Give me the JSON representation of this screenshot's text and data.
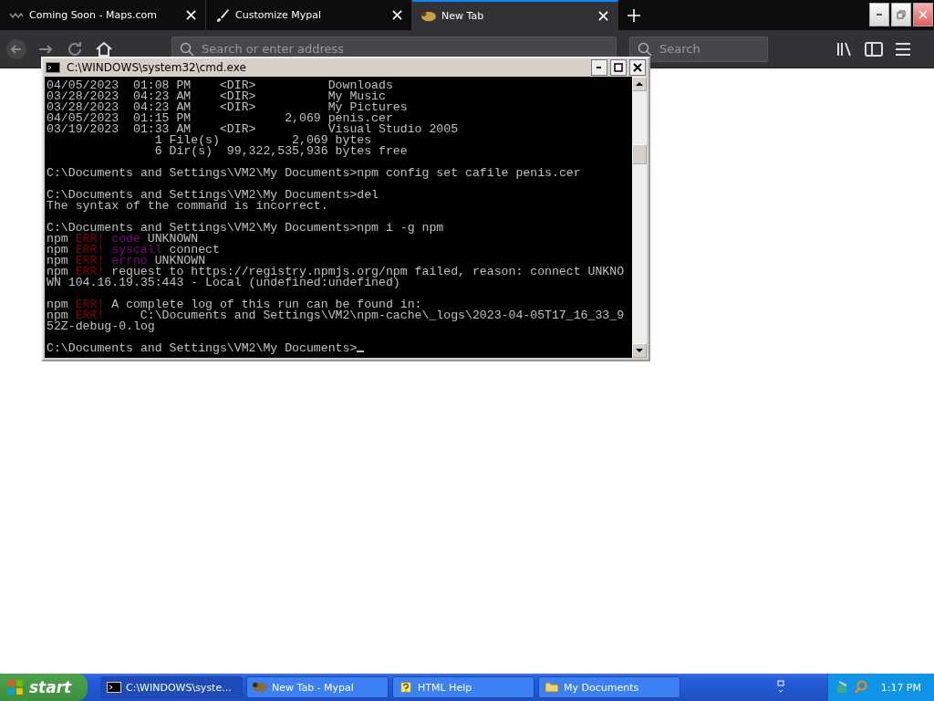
{
  "browser": {
    "tabs": [
      {
        "label": "Coming Soon - Maps.com",
        "selected": false
      },
      {
        "label": "Customize Mypal",
        "selected": false
      },
      {
        "label": "New Tab",
        "selected": true
      }
    ],
    "address": {
      "placeholder": "Search or enter address"
    },
    "search": {
      "placeholder": "Search"
    }
  },
  "console": {
    "title": "C:\\WINDOWS\\system32\\cmd.exe",
    "blocks": [
      [
        [
          {
            "kind": "out",
            "text": "04/05/2023  01:08 PM    <DIR>          Downloads"
          }
        ],
        [
          {
            "kind": "out",
            "text": "03/28/2023  04:23 AM    <DIR>          My Music"
          }
        ],
        [
          {
            "kind": "out",
            "text": "03/28/2023  04:23 AM    <DIR>          My Pictures"
          }
        ],
        [
          {
            "kind": "out",
            "text": "04/05/2023  01:15 PM             2,069 penis.cer"
          }
        ],
        [
          {
            "kind": "out",
            "text": "03/19/2023  01:33 AM    <DIR>          Visual Studio 2005"
          }
        ],
        [
          {
            "kind": "out",
            "text": "               1 File(s)          2,069 bytes"
          }
        ],
        [
          {
            "kind": "out",
            "text": "               6 Dir(s)  99,322,535,936 bytes free"
          }
        ]
      ],
      [
        [
          {
            "kind": "out",
            "text": "C:\\Documents and Settings\\VM2\\My Documents>npm config set cafile penis.cer"
          }
        ]
      ],
      [
        [
          {
            "kind": "out",
            "text": "C:\\Documents and Settings\\VM2\\My Documents>del"
          }
        ],
        [
          {
            "kind": "out",
            "text": "The syntax of the command is incorrect."
          }
        ]
      ],
      [
        [
          {
            "kind": "out",
            "text": "C:\\Documents and Settings\\VM2\\My Documents>npm i -g npm"
          }
        ],
        [
          {
            "kind": "out",
            "text": "npm "
          },
          {
            "kind": "err",
            "text": "ERR!"
          },
          {
            "kind": "key",
            "text": "code"
          },
          {
            "kind": "out",
            "text": " UNKNOWN"
          }
        ],
        [
          {
            "kind": "out",
            "text": "npm "
          },
          {
            "kind": "err",
            "text": "ERR!"
          },
          {
            "kind": "key",
            "text": "syscall"
          },
          {
            "kind": "out",
            "text": " connect"
          }
        ],
        [
          {
            "kind": "out",
            "text": "npm "
          },
          {
            "kind": "err",
            "text": "ERR!"
          },
          {
            "kind": "key",
            "text": "errno"
          },
          {
            "kind": "out",
            "text": " UNKNOWN"
          }
        ],
        [
          {
            "kind": "out",
            "text": "npm "
          },
          {
            "kind": "err",
            "text": "ERR!"
          },
          {
            "kind": "out",
            "text": "request to https://registry.npmjs.org/npm failed, reason: connect UNKNO"
          }
        ],
        [
          {
            "kind": "out",
            "text": "WN 104.16.19.35:443 - Local (undefined:undefined)"
          }
        ]
      ],
      [
        [
          {
            "kind": "out",
            "text": "npm "
          },
          {
            "kind": "err",
            "text": "ERR!"
          },
          {
            "kind": "out",
            "text": "A complete log of this run can be found in:"
          }
        ],
        [
          {
            "kind": "out",
            "text": "npm "
          },
          {
            "kind": "err",
            "text": "ERR!"
          },
          {
            "kind": "out",
            "text": "    C:\\Documents and Settings\\VM2\\npm-cache\\_logs\\2023-04-05T17_16_33_9"
          }
        ],
        [
          {
            "kind": "out",
            "text": "52Z-debug-0.log"
          }
        ]
      ],
      [
        [
          {
            "kind": "out",
            "text": "C:\\Documents and Settings\\VM2\\My Documents>"
          }
        ]
      ]
    ],
    "cursor": true
  },
  "taskbar": {
    "start": "start",
    "items": [
      {
        "label": "C:\\WINDOWS\\syste...",
        "selected": true
      },
      {
        "label": "New Tab - Mypal",
        "selected": false
      },
      {
        "label": "HTML Help",
        "selected": false
      },
      {
        "label": "My Documents",
        "selected": false
      }
    ],
    "clock": "1:17 PM"
  }
}
